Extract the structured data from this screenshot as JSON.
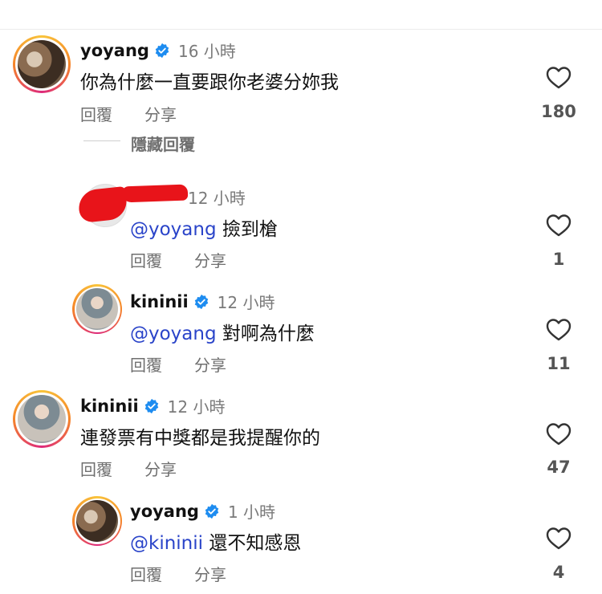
{
  "ui": {
    "reply_label": "回覆",
    "share_label": "分享",
    "hide_replies_label": "隱藏回覆"
  },
  "colors": {
    "mention": "#2a44c9",
    "verified": "#1d8cf0",
    "redaction": "#e8141a"
  },
  "comments": [
    {
      "username": "yoyang",
      "verified": true,
      "time": "16 小時",
      "text": "你為什麼一直要跟你老婆分妳我",
      "likes": "180"
    },
    {
      "username": "",
      "redacted": true,
      "time": "12 小時",
      "mention": "@yoyang",
      "text": "撿到槍",
      "likes": "1"
    },
    {
      "username": "kininii",
      "verified": true,
      "time": "12 小時",
      "mention": "@yoyang",
      "text": "對啊為什麼",
      "likes": "11"
    },
    {
      "username": "kininii",
      "verified": true,
      "time": "12 小時",
      "text": "連發票有中獎都是我提醒你的",
      "likes": "47"
    },
    {
      "username": "yoyang",
      "verified": true,
      "time": "1 小時",
      "mention": "@kininii",
      "text": "還不知感恩",
      "likes": "4"
    }
  ]
}
